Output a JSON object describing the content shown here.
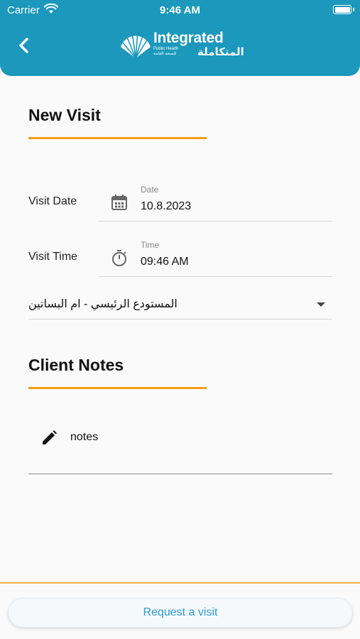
{
  "status_bar": {
    "carrier": "Carrier",
    "time": "9:46 AM"
  },
  "header": {
    "back_icon": "chevron-left-icon",
    "logo_word": "Integrated",
    "logo_small": "Public Health للصحة العامة",
    "logo_arabic": "المتكاملة"
  },
  "colors": {
    "primary": "#1b98bb",
    "accent": "#f39c12",
    "button_text": "#2e9bd6"
  },
  "new_visit": {
    "title": "New Visit",
    "visit_date": {
      "label": "Visit Date",
      "field_label": "Date",
      "value": "10.8.2023",
      "icon": "calendar-icon"
    },
    "visit_time": {
      "label": "Visit Time",
      "field_label": "Time",
      "value": "09:46 AM",
      "icon": "timer-icon"
    },
    "warehouse": {
      "value": "المستودع الرئيسي - ام البساتين",
      "icon": "dropdown-caret-icon"
    }
  },
  "client_notes": {
    "title": "Client Notes",
    "placeholder": "notes",
    "icon": "pencil-icon"
  },
  "footer": {
    "request_button": "Request a visit"
  }
}
